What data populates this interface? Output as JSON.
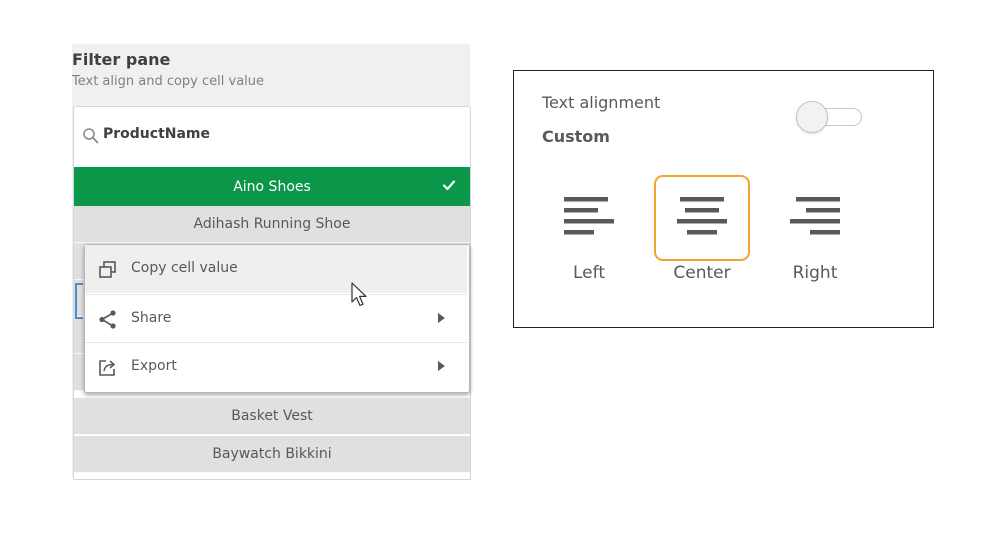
{
  "filter_pane": {
    "title": "Filter pane",
    "subtitle": "Text align and copy cell value",
    "field": "ProductName",
    "rows": [
      {
        "label": "Aino Shoes",
        "state": "selected"
      },
      {
        "label": "Adihash Running Shoe",
        "state": "possible"
      },
      {
        "label": "",
        "state": "hidden"
      },
      {
        "label": "",
        "state": "hidden"
      },
      {
        "label": "",
        "state": "hidden"
      },
      {
        "label": "",
        "state": "hidden"
      },
      {
        "label": "Basket Vest",
        "state": "possible"
      },
      {
        "label": "Baywatch Bikkini",
        "state": "possible"
      }
    ],
    "colors": {
      "selected": "#0b9649",
      "possible": "#e0e0e0"
    }
  },
  "context_menu": {
    "items": [
      {
        "label": "Copy cell value",
        "icon": "copy-icon",
        "submenu": false
      },
      {
        "label": "Share",
        "icon": "share-icon",
        "submenu": true
      },
      {
        "label": "Export",
        "icon": "export-icon",
        "submenu": true
      }
    ]
  },
  "alignment_panel": {
    "title": "Text alignment",
    "mode": "Custom",
    "toggle_on": false,
    "options": [
      {
        "label": "Left",
        "icon": "align-left-icon",
        "selected": false
      },
      {
        "label": "Center",
        "icon": "align-center-icon",
        "selected": true
      },
      {
        "label": "Right",
        "icon": "align-right-icon",
        "selected": false
      }
    ],
    "colors": {
      "selected_outline": "#f3a331"
    }
  }
}
